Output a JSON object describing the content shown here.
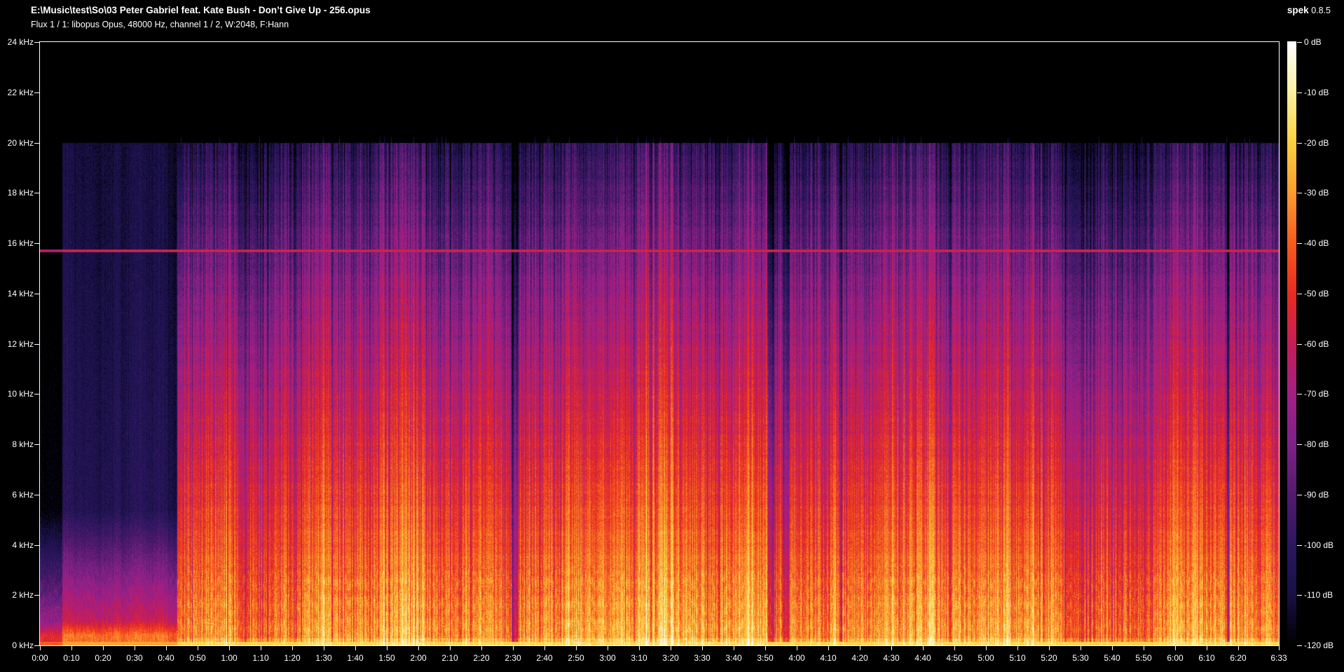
{
  "header": {
    "title": "E:\\Music\\test\\So\\03 Peter Gabriel feat. Kate Bush - Don’t Give Up - 256.opus",
    "subtitle": "Flux 1 / 1: libopus Opus, 48000 Hz, channel 1 / 2, W:2048, F:Hann",
    "app_name": "spek",
    "app_version": "0.8.5"
  },
  "chart_data": {
    "type": "heatmap",
    "subtype": "audio-spectrogram",
    "title": "03 Peter Gabriel feat. Kate Bush - Don’t Give Up - 256.opus",
    "x_axis": {
      "unit": "m:ss",
      "duration_seconds": 393,
      "ticks": [
        "0:00",
        "0:10",
        "0:20",
        "0:30",
        "0:40",
        "0:50",
        "1:00",
        "1:10",
        "1:20",
        "1:30",
        "1:40",
        "1:50",
        "2:00",
        "2:10",
        "2:20",
        "2:30",
        "2:40",
        "2:50",
        "3:00",
        "3:10",
        "3:20",
        "3:30",
        "3:40",
        "3:50",
        "4:00",
        "4:10",
        "4:20",
        "4:30",
        "4:40",
        "4:50",
        "5:00",
        "5:10",
        "5:20",
        "5:30",
        "5:40",
        "5:50",
        "6:00",
        "6:10",
        "6:20",
        "6:33"
      ]
    },
    "y_axis": {
      "unit": "kHz",
      "range_khz": [
        0,
        24
      ],
      "ticks": [
        "24 kHz",
        "22 kHz",
        "20 kHz",
        "18 kHz",
        "16 kHz",
        "14 kHz",
        "12 kHz",
        "10 kHz",
        "8 kHz",
        "6 kHz",
        "4 kHz",
        "2 kHz",
        "0 kHz"
      ]
    },
    "colorbar": {
      "unit": "dB",
      "range_db": [
        0,
        -120
      ],
      "ticks": [
        "0 dB",
        "-10 dB",
        "-20 dB",
        "-30 dB",
        "-40 dB",
        "-50 dB",
        "-60 dB",
        "-70 dB",
        "-80 dB",
        "-90 dB",
        "-100 dB",
        "-110 dB",
        "-120 dB"
      ],
      "palette": [
        {
          "db": 0,
          "color": "#ffffff"
        },
        {
          "db": -10,
          "color": "#fdf0a0"
        },
        {
          "db": -20,
          "color": "#fdd040"
        },
        {
          "db": -30,
          "color": "#fc9b30"
        },
        {
          "db": -40,
          "color": "#f75b20"
        },
        {
          "db": -50,
          "color": "#e92b21"
        },
        {
          "db": -60,
          "color": "#c61d57"
        },
        {
          "db": -70,
          "color": "#a31f85"
        },
        {
          "db": -80,
          "color": "#7e2287"
        },
        {
          "db": -90,
          "color": "#531a6e"
        },
        {
          "db": -100,
          "color": "#2c175f"
        },
        {
          "db": -110,
          "color": "#171044"
        },
        {
          "db": -120,
          "color": "#000000"
        }
      ]
    },
    "features": {
      "bandwidth_cutoff_khz": 20,
      "tone_line_khz": 15.7,
      "music_start": "0:44",
      "quiet_outro_start": "5:28",
      "track_end": "6:33"
    }
  }
}
